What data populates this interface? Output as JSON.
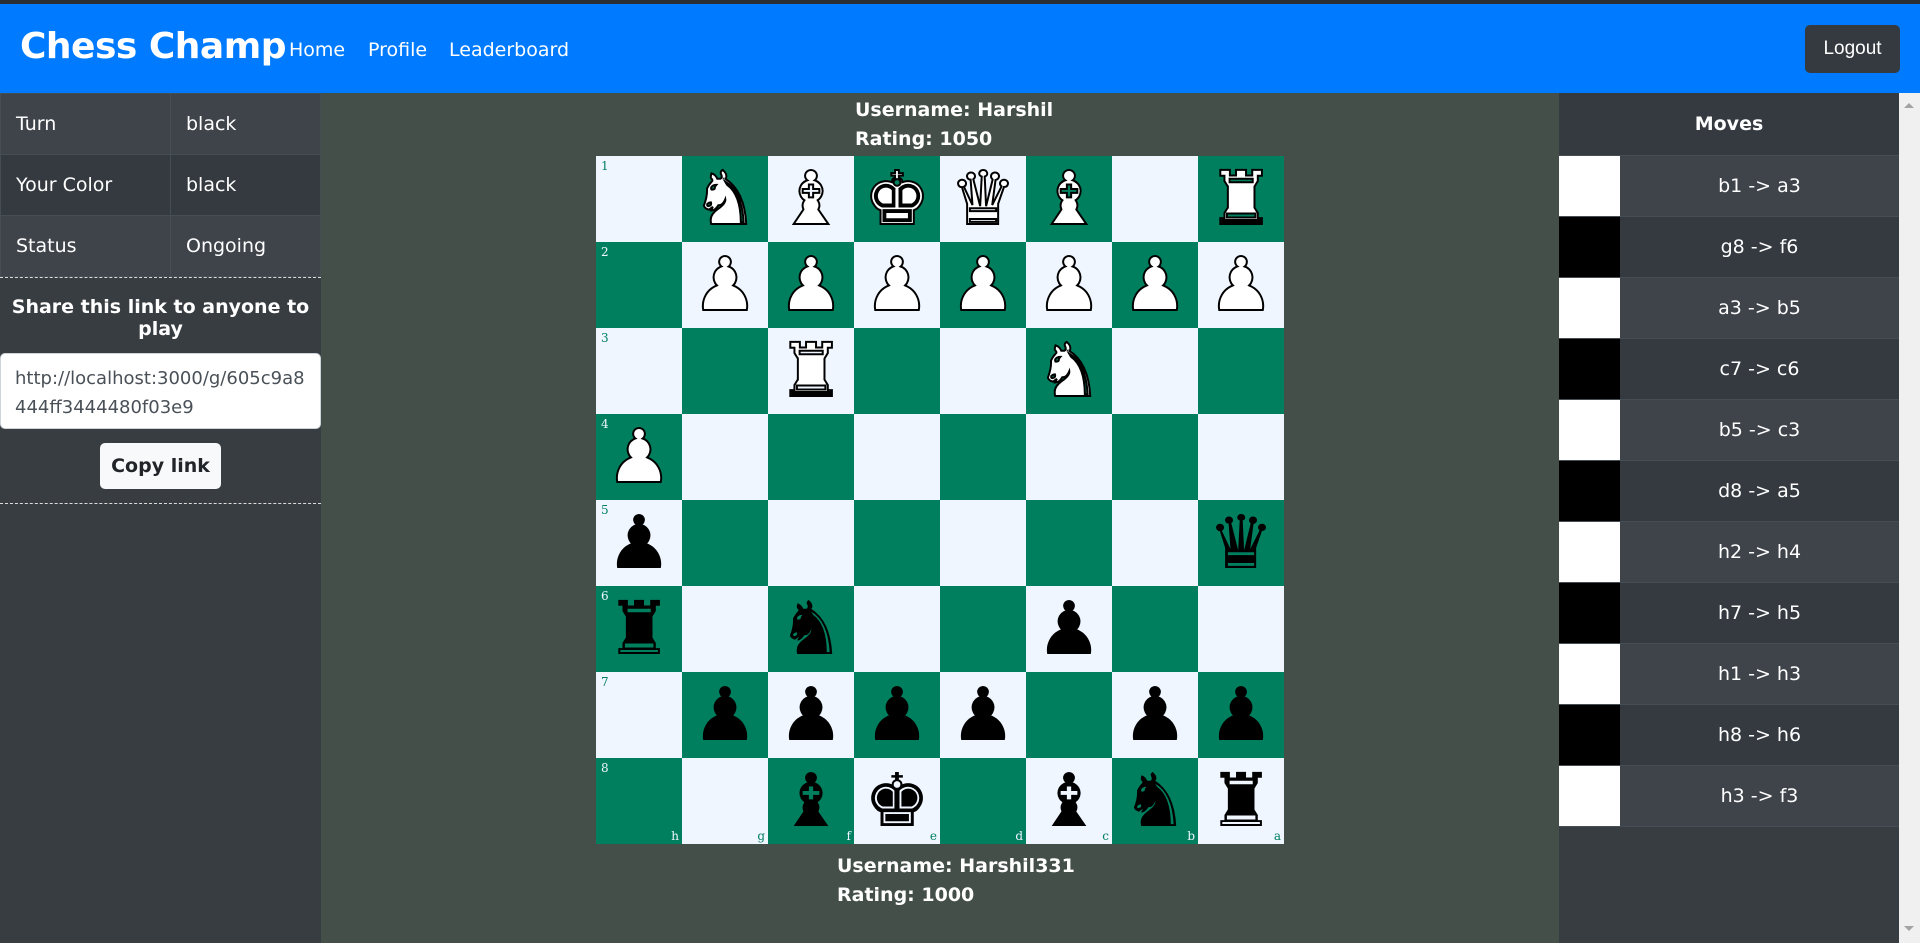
{
  "navbar": {
    "brand": "Chess Champ",
    "links": [
      "Home",
      "Profile",
      "Leaderboard"
    ],
    "logout_label": "Logout",
    "color": "#007bff"
  },
  "game_info": {
    "rows": [
      {
        "label": "Turn",
        "value": "black"
      },
      {
        "label": "Your Color",
        "value": "black"
      },
      {
        "label": "Status",
        "value": "Ongoing"
      }
    ]
  },
  "share": {
    "title": "Share this link to anyone to play",
    "link": "http://localhost:3000/g/605c9a8444ff3444480f03e9",
    "copy_label": "Copy link"
  },
  "opponent": {
    "username_text": "Username: Harshil",
    "rating_text": "Rating: 1050"
  },
  "player": {
    "username_text": "Username: Harshil331",
    "rating_text": "Rating: 1000"
  },
  "board": {
    "orientation": "black",
    "rank_labels": [
      "1",
      "2",
      "3",
      "4",
      "5",
      "6",
      "7",
      "8"
    ],
    "file_labels": [
      "h",
      "g",
      "f",
      "e",
      "d",
      "c",
      "b",
      "a"
    ],
    "rows": [
      [
        "",
        "wN",
        "wB",
        "wK",
        "wQ",
        "wB",
        "",
        "wR"
      ],
      [
        "",
        "wP",
        "wP",
        "wP",
        "wP",
        "wP",
        "wP",
        "wP"
      ],
      [
        "",
        "",
        "wR",
        "",
        "",
        "wN",
        "",
        ""
      ],
      [
        "wP",
        "",
        "",
        "",
        "",
        "",
        "",
        ""
      ],
      [
        "bP",
        "",
        "",
        "",
        "",
        "",
        "",
        "bQ"
      ],
      [
        "bR",
        "",
        "bN",
        "",
        "",
        "bP",
        "",
        ""
      ],
      [
        "",
        "bP",
        "bP",
        "bP",
        "bP",
        "",
        "bP",
        "bP"
      ],
      [
        "",
        "",
        "bB",
        "bK",
        "",
        "bB",
        "bN",
        "bR"
      ]
    ],
    "light_color": "#eff6ff",
    "dark_color": "#007f5f"
  },
  "moves": {
    "title": "Moves",
    "list": [
      {
        "color": "white",
        "text": "b1 -> a3"
      },
      {
        "color": "black",
        "text": "g8 -> f6"
      },
      {
        "color": "white",
        "text": "a3 -> b5"
      },
      {
        "color": "black",
        "text": "c7 -> c6"
      },
      {
        "color": "white",
        "text": "b5 -> c3"
      },
      {
        "color": "black",
        "text": "d8 -> a5"
      },
      {
        "color": "white",
        "text": "h2 -> h4"
      },
      {
        "color": "black",
        "text": "h7 -> h5"
      },
      {
        "color": "white",
        "text": "h1 -> h3"
      },
      {
        "color": "black",
        "text": "h8 -> h6"
      },
      {
        "color": "white",
        "text": "h3 -> f3"
      }
    ]
  }
}
